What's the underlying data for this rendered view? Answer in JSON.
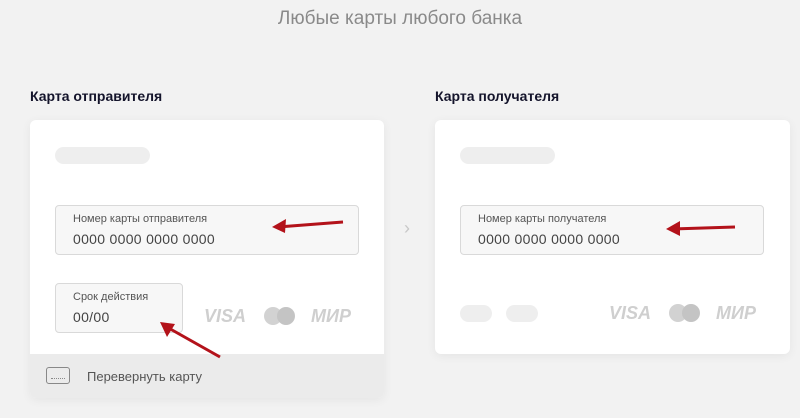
{
  "header": {
    "subtitle": "Любые карты любого банка"
  },
  "sender": {
    "title": "Карта отправителя",
    "card_number_label": "Номер карты отправителя",
    "card_number_placeholder": "0000 0000 0000 0000",
    "expiry_label": "Срок действия",
    "expiry_placeholder": "00/00",
    "brands": [
      "VISA",
      "МИР"
    ],
    "flip_label": "Перевернуть карту"
  },
  "recipient": {
    "title": "Карта получателя",
    "card_number_label": "Номер карты получателя",
    "card_number_placeholder": "0000 0000 0000 0000",
    "brands": [
      "VISA",
      "МИР"
    ]
  },
  "icons": {
    "chevron": "chevron-right-icon",
    "flip": "card-icon",
    "annotation": "red-arrow-icon"
  },
  "colors": {
    "annotation_arrow": "#b3121a",
    "background": "#f2f2f2"
  }
}
